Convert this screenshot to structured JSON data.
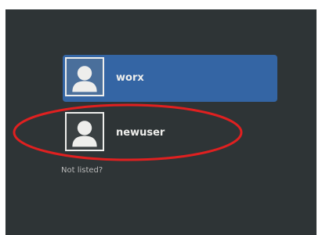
{
  "login": {
    "users": [
      {
        "name": "worx",
        "selected": true,
        "avatar_icon": "user-avatar-icon"
      },
      {
        "name": "newuser",
        "selected": false,
        "avatar_icon": "user-avatar-icon"
      }
    ],
    "not_listed_label": "Not listed?"
  },
  "colors": {
    "background": "#2e3436",
    "selected_row": "#3465a4",
    "text": "#eeeeec",
    "muted_text": "#bababa",
    "annotation": "#e02020"
  }
}
